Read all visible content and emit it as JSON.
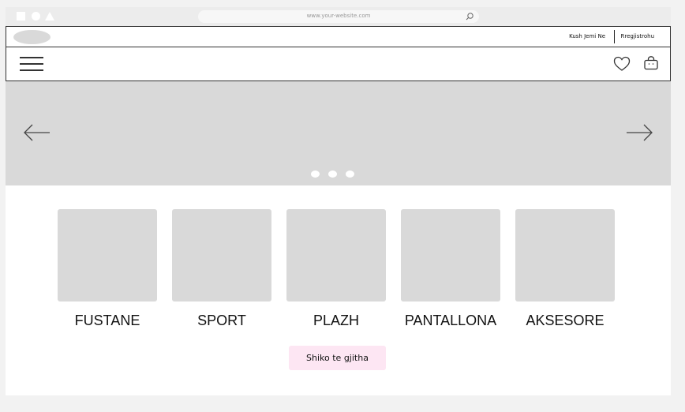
{
  "browser": {
    "url": "www.your-website.com"
  },
  "topbar": {
    "about_label": "Kush Jemi Ne",
    "register_label": "Rregjistrohu"
  },
  "icons": {
    "menu": "hamburger-menu-icon",
    "wishlist": "heart-icon",
    "cart": "shopping-bag-icon",
    "prev": "arrow-left-icon",
    "next": "arrow-right-icon",
    "search": "search-icon"
  },
  "carousel": {
    "slide_count": 3
  },
  "categories": [
    {
      "label": "FUSTANE"
    },
    {
      "label": "SPORT"
    },
    {
      "label": "PLAZH"
    },
    {
      "label": "PANTALLONA"
    },
    {
      "label": "AKSESORE"
    }
  ],
  "view_all_label": "Shiko te gjitha",
  "colors": {
    "placeholder": "#d9d9d9",
    "accent_button": "#fde6f3",
    "border": "#333333"
  }
}
